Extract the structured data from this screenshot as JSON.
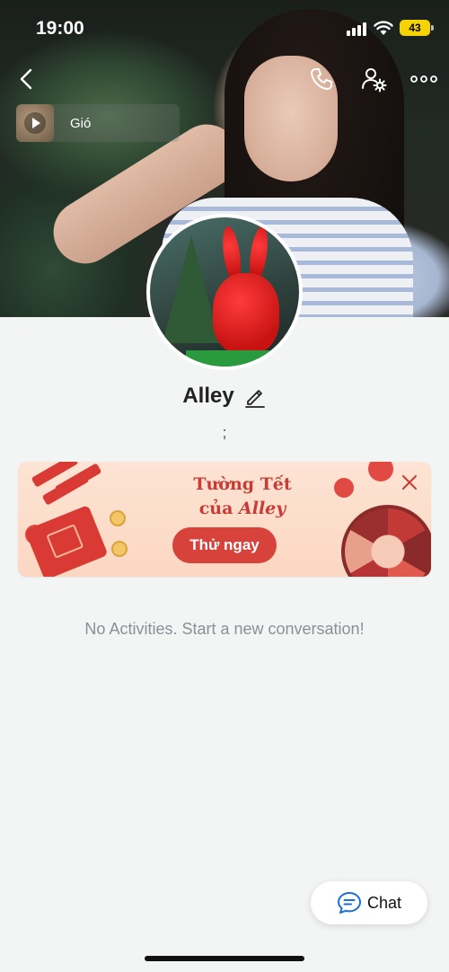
{
  "status_bar": {
    "time": "19:00",
    "battery": "43"
  },
  "nav": {
    "back_icon": "chevron-left-icon",
    "call_icon": "phone-icon",
    "settings_icon": "user-settings-icon",
    "more_icon": "more-horizontal-icon"
  },
  "music": {
    "title": "Gió",
    "icon": "play-icon"
  },
  "profile": {
    "name": "Alley",
    "status": ";",
    "edit_icon": "pencil-icon"
  },
  "banner": {
    "title_line1": "Tường Tết",
    "title_line2_prefix": "của ",
    "title_line2_name": "Alley",
    "button_label": "Thử ngay",
    "close_icon": "close-icon",
    "accent_color": "#d7433b"
  },
  "empty_state": {
    "message": "No Activities. Start a new conversation!"
  },
  "chat_button": {
    "label": "Chat",
    "icon": "chat-bubble-icon",
    "accent_color": "#1a6fd8"
  }
}
